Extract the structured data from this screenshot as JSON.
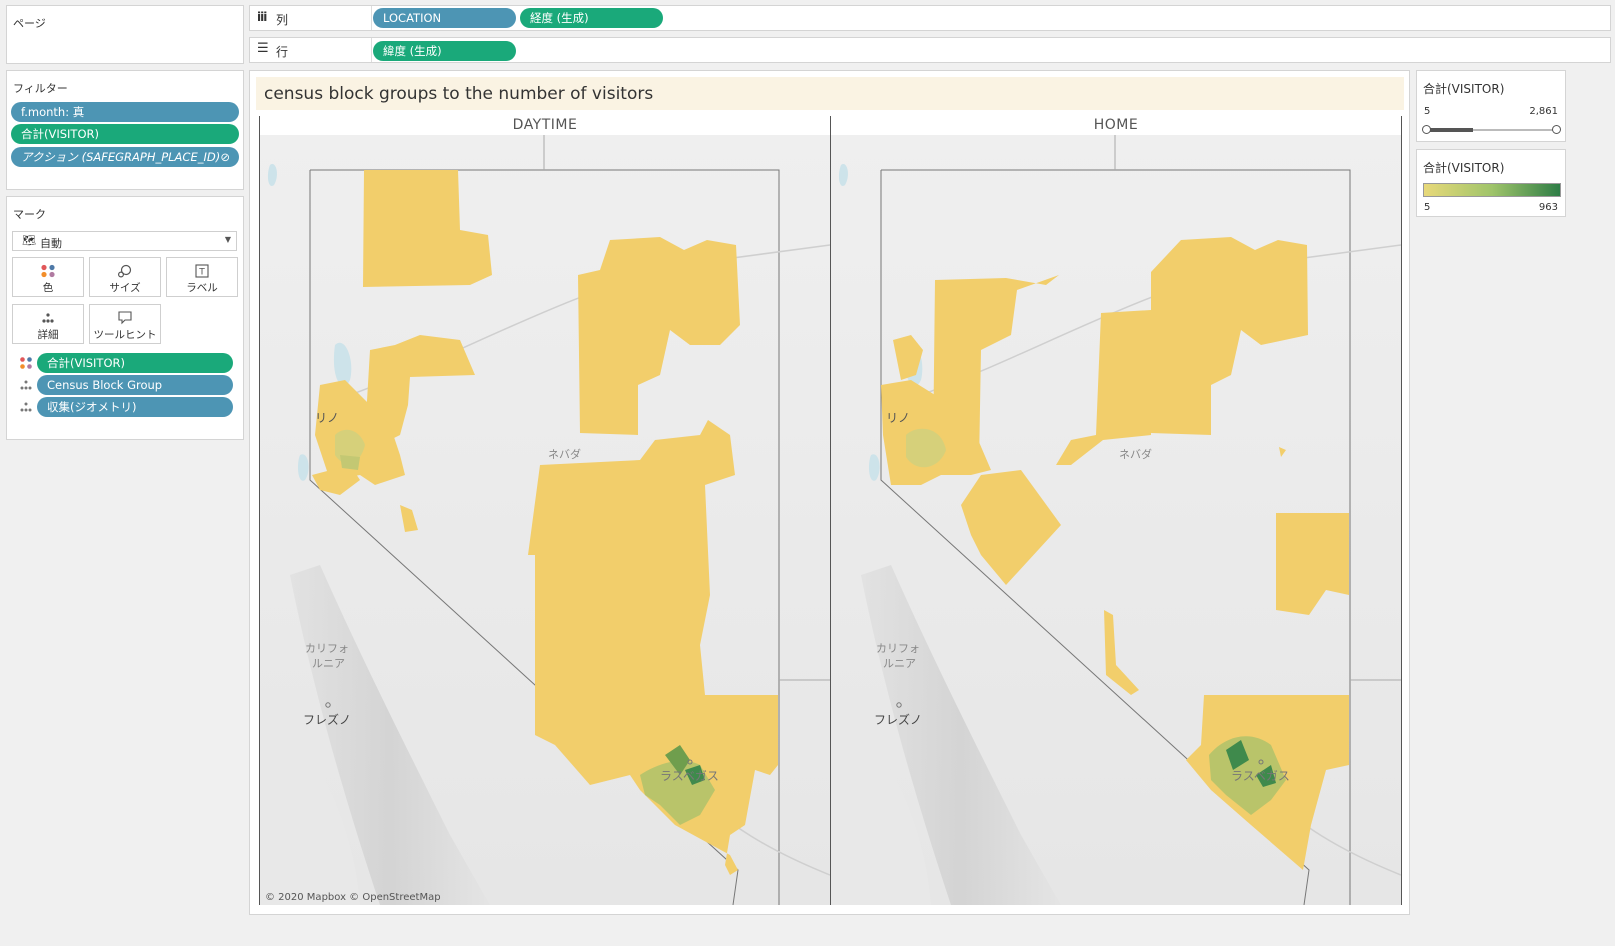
{
  "shelves": {
    "page_label": "ページ",
    "columns_label": "列",
    "rows_label": "行",
    "columns": [
      "LOCATION",
      "経度 (生成)"
    ],
    "rows": [
      "緯度 (生成)"
    ]
  },
  "filters": {
    "title": "フィルター",
    "items": [
      "f.month: 真",
      "合計(VISITOR)",
      "アクション (SAFEGRAPH_PLACE_ID)"
    ]
  },
  "marks": {
    "title": "マーク",
    "type_label": "自動",
    "buttons": [
      "色",
      "サイズ",
      "ラベル",
      "詳細",
      "ツールヒント"
    ],
    "fields": [
      "合計(VISITOR)",
      "Census Block Group",
      "収集(ジオメトリ)"
    ]
  },
  "view": {
    "title": "census block groups to  the number of visitors",
    "column_headers": [
      "DAYTIME",
      "HOME"
    ],
    "map_labels": {
      "reno": "リノ",
      "nevada": "ネバダ",
      "california_1": "カリフォ",
      "california_2": "ルニア",
      "fresno": "フレズノ",
      "las_vegas": "ラスベガス"
    },
    "attribution": "© 2020 Mapbox © OpenStreetMap"
  },
  "legend_filter": {
    "title": "合計(VISITOR)",
    "min": "5",
    "max": "2,861",
    "slider_fraction_start": 0,
    "slider_fraction_end": 1
  },
  "legend_color": {
    "title": "合計(VISITOR)",
    "min": "5",
    "max": "963",
    "color_start": "#e8d97a",
    "color_end": "#2e7d46"
  },
  "colors": {
    "pill_blue": "#4d95b4",
    "pill_green": "#1aa97a",
    "region_fill": "#f2ce6b",
    "title_bg": "#faf3e3"
  }
}
